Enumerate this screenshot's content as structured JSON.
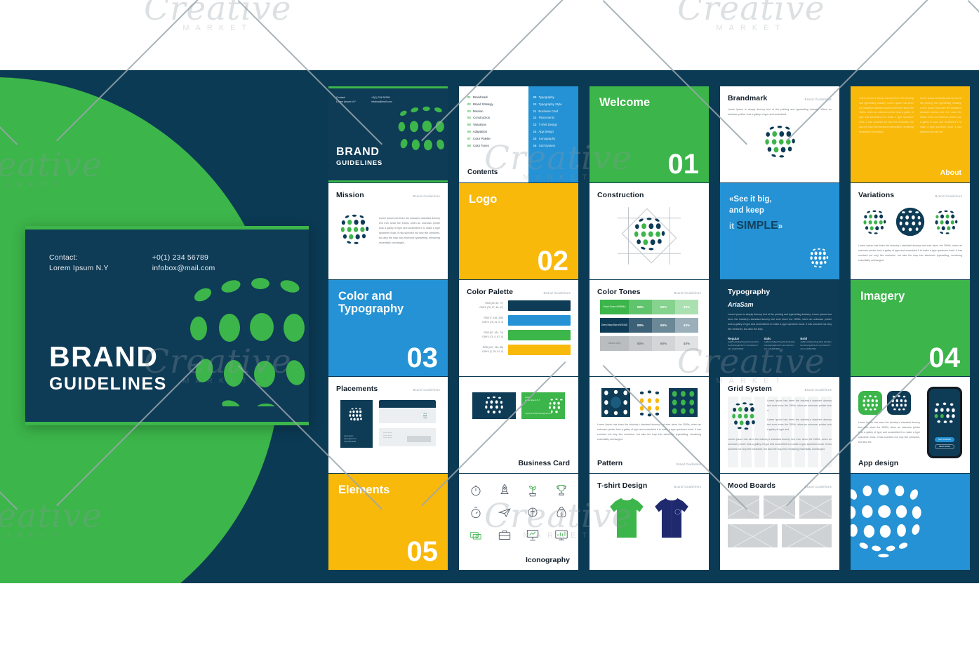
{
  "cover": {
    "contact_label": "Contact:",
    "contact_name": "Lorem Ipsum N.Y",
    "phone": "+0(1) 234 56789",
    "email": "infobox@mail.com",
    "title_line1": "BRAND",
    "title_line2": "GUIDELINES"
  },
  "watermark": {
    "word": "Creative",
    "sub": "MARKET"
  },
  "colors": {
    "navy": "#0e3b56",
    "green": "#3cb54a",
    "blue": "#2492d4",
    "amber": "#f9b90a",
    "white": "#ffffff"
  },
  "slides": {
    "cover_thumb": {
      "contact_label": "Contact:",
      "contact_name": "Lorem Ipsum N.Y",
      "phone": "+0(1) 234 56789",
      "email": "infobox@mail.com",
      "title_line1": "BRAND",
      "title_line2": "GUIDELINES"
    },
    "contents": {
      "word": "Contents",
      "left": [
        {
          "n": "01",
          "label": "Brandmark"
        },
        {
          "n": "02",
          "label": "Brand Strategy"
        },
        {
          "n": "03",
          "label": "Mission"
        },
        {
          "n": "04",
          "label": "Construction"
        },
        {
          "n": "05",
          "label": "Variations"
        },
        {
          "n": "06",
          "label": "Adaptation"
        },
        {
          "n": "07",
          "label": "Color Palette"
        },
        {
          "n": "08",
          "label": "Color Tones"
        }
      ],
      "right": [
        {
          "n": "09",
          "label": "Typography"
        },
        {
          "n": "10",
          "label": "Typography Style"
        },
        {
          "n": "11",
          "label": "Business Card"
        },
        {
          "n": "12",
          "label": "Placements"
        },
        {
          "n": "13",
          "label": "T-shirt Design"
        },
        {
          "n": "14",
          "label": "App design"
        },
        {
          "n": "15",
          "label": "Iconography"
        },
        {
          "n": "16",
          "label": "Grid System"
        }
      ]
    },
    "welcome": {
      "label": "Welcome",
      "number": "01"
    },
    "brandmark": {
      "title": "Brandmark",
      "tag": "Brand Guidelines",
      "body": "Lorem Ipsum is simply dummy text of the printing and typesetting industry. When an unknown printer took a galley of type and scrambled."
    },
    "about": {
      "word": "About",
      "col1": "Lorem Ipsum is simply dummy text of the printing and typesetting industry. Lorem Ipsum has been the industry's standard dummy text ever since the 1500s, when an unknown printer took a galley of type and scrambled it to make a type specimen book. It has survived not only five centuries, but also the leap into electronic typesetting, remaining essentially unchanged.",
      "col2": "Lorem Ipsum is simply dummy text of the printing and typesetting industry. Lorem Ipsum has been the industry's standard dummy text ever since the 1500s, when an unknown printer took a galley of type and scrambled it to make a type specimen book. It has survived not only five."
    },
    "mission": {
      "title": "Mission",
      "tag": "Brand Guidelines",
      "body": "Lorem Ipsum has been the industry's standard dummy text ever since the 1500s, when an unknown printer took a galley of type and scrambled it to make a type specimen book. It has survived not only five centuries, but also the leap into electronic typesetting, remaining essentially unchanged."
    },
    "logo": {
      "label": "Logo",
      "number": "02"
    },
    "construction": {
      "title": "Construction",
      "tag": ""
    },
    "quote": {
      "line1": "«See it big,",
      "line2": "and keep",
      "line3_small": "it ",
      "line3_big": "SIMPLE",
      "line3_end": "»"
    },
    "variations": {
      "title": "Variations",
      "tag": "Brand Guidelines",
      "body": "Lorem Ipsum has been the industry's standard dummy text ever since the 1500s, when an unknown printer took a galley of type and scrambled it to make a type specimen book. It has survived not only five centuries, but also the leap into electronic typesetting, remaining essentially unchanged."
    },
    "color_typography": {
      "label_line1": "Color and",
      "label_line2": "Typography",
      "number": "03"
    },
    "color_palette": {
      "title": "Color Palette",
      "tag": "Brand Guidelines",
      "swatches": [
        {
          "rgb": "RGB (30, 69, 77)",
          "cmyk": "CMYK (76, 37, 46, 47)",
          "hex": "#0e3b56"
        },
        {
          "rgb": "RGB (7, 146, 255)",
          "cmyk": "CMYK (75, 31, 0, 0)",
          "hex": "#2492d4"
        },
        {
          "rgb": "RGB (57, 181, 74)",
          "cmyk": "CMYK (71, 0, 87, 0)",
          "hex": "#3cb54a"
        },
        {
          "rgb": "RGB (247, 184, 88)",
          "cmyk": "CMYK (2, 29, 91, 0)",
          "hex": "#f9b90a"
        }
      ]
    },
    "color_tones": {
      "title": "Color Tones",
      "tag": "Brand Guidelines",
      "rows": [
        {
          "name": "Fresh Green #39B54A",
          "base": "#3cb54a",
          "steps": [
            {
              "pct": "80%",
              "hex": "#60c46c"
            },
            {
              "pct": "60%",
              "hex": "#86d28f"
            },
            {
              "pct": "40%",
              "hex": "#abe0b1"
            }
          ]
        },
        {
          "name": "Deep Navy Blue #1E454D",
          "base": "#0e3b56",
          "steps": [
            {
              "pct": "80%",
              "hex": "#3d6277"
            },
            {
              "pct": "60%",
              "hex": "#6b8897"
            },
            {
              "pct": "40%",
              "hex": "#9aafb9"
            }
          ]
        },
        {
          "name": "Neutral Grey",
          "base": "#b9bdbf",
          "steps": [
            {
              "pct": "80%",
              "hex": "#c6c9cb"
            },
            {
              "pct": "60%",
              "hex": "#d3d5d7"
            },
            {
              "pct": "40%",
              "hex": "#e0e2e3"
            }
          ]
        }
      ]
    },
    "typography": {
      "title": "Typography",
      "font_name": "AriaSam",
      "body": "Lorem Ipsum is simply dummy text of the printing and typesetting industry. Lorem Ipsum has been the industry's standard dummy text ever since the 1500s, when an unknown printer took a galley of type and scrambled it to make a type specimen book. It has survived not only five centuries, but also the leap.",
      "weights": [
        {
          "label": "Regular",
          "sample": "AaBbCcDdEeFfGgHhIiJj KkLlMmNnOoPpQqRrSsTt UuVvWwXxYyZz 1234567890"
        },
        {
          "label": "Italic",
          "sample": "AaBbCcDdEeFfGgHhIiJj KkLlMmNnOoPpQqRrSsTt UuVvWwXxYyZz 1234567890"
        },
        {
          "label": "Bold",
          "sample": "AaBbCcDdEeFfGgHhIiJj KkLlMmNnOoPpQqRrSsTt UuVvWwXxYyZz 1234567890"
        }
      ]
    },
    "imagery": {
      "label": "Imagery",
      "number": "04"
    },
    "placements": {
      "title": "Placements",
      "tag": "Brand Guidelines"
    },
    "business_card": {
      "word": "Business Card",
      "card_name": "Lorem",
      "card_sub": "Lorem Ipsum N.Y",
      "card_contact": "+0(1) 234 56789 infobox@mail.com"
    },
    "pattern": {
      "word": "Pattern",
      "tag": "Brand Guidelines",
      "body": "Lorem Ipsum has been the industry's standard dummy text ever since the 1500s, when an unknown printer took a galley of type and scrambled it to make a type specimen book. It has survived not only five centuries, but also the leap into electronic typesetting, remaining essentially unchanged."
    },
    "grid_system": {
      "title": "Grid System",
      "tag": "Brand Guidelines",
      "body1": "Lorem Ipsum has been the industry's standard dummy text ever since the 1500s, when an unknown printer took a",
      "body2": "Lorem Ipsum has been the industry's standard dummy text ever since the 1500s, when an unknown printer took a galley of type and",
      "body3": "Lorem Ipsum has been the industry's standard dummy text ever since the 1500s, when an unknown printer took a galley of type and scrambled it to make a type specimen book. It has survived not only five centuries, but also the leap into remaining essentially unchanged."
    },
    "app_design": {
      "word": "App design",
      "body": "Lorem Ipsum has been the industry's standard dummy text ever since the 1500s, when an unknown printer took a galley of type and scrambled it to make a type specimen book. It has survived not only five centuries, but also the",
      "btn_primary": "GET STARTED",
      "btn_secondary": "READ MORE"
    },
    "elements": {
      "label": "Elements",
      "number": "05"
    },
    "iconography": {
      "word": "Iconography"
    },
    "tshirt": {
      "title": "T-shirt Design",
      "tag": "Brand Guidelines"
    },
    "mood_boards": {
      "title": "Mood Boards",
      "tag": "Brand Guidelines"
    },
    "logo_blue": {
      "alt": "brandmark-large"
    }
  }
}
